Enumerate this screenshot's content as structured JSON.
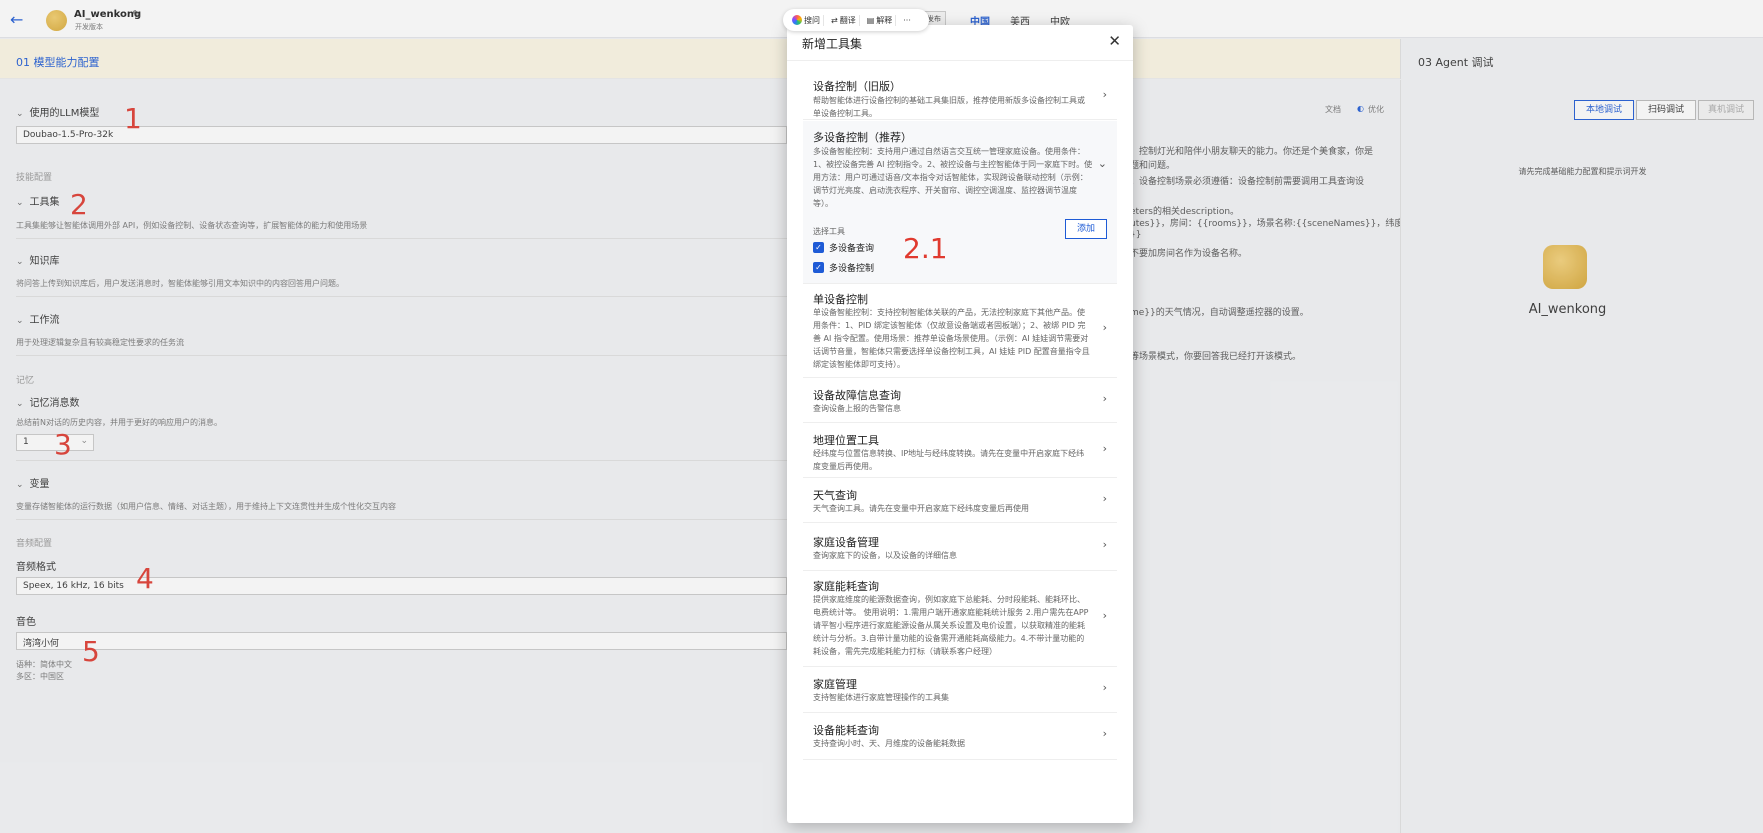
{
  "topbar": {
    "agent_name": "AI_wenkong",
    "agent_sub": "开发版本",
    "tabs": [
      "中国",
      "美西",
      "中欧"
    ],
    "mini_button": "发布"
  },
  "float_toolbar": {
    "items": [
      "搜问",
      "翻译",
      "解释",
      "···"
    ]
  },
  "section_bar": {
    "left": "01  模型能力配置",
    "right": "03  Agent 调试"
  },
  "left": {
    "llm_label": "使用的LLM模型",
    "llm_value": "Doubao-1.5-Pro-32k",
    "skill_group": "技能配置",
    "toolset_label": "工具集",
    "toolset_desc": "工具集能够让智能体调用外部 API，例如设备控制、设备状态查询等，扩展智能体的能力和使用场景",
    "kb_label": "知识库",
    "kb_desc": "将问答上传到知识库后，用户发送消息时，智能体能够引用文本知识中的内容回答用户问题。",
    "workflow_label": "工作流",
    "workflow_desc": "用于处理逻辑复杂且有较高稳定性要求的任务流",
    "memory_group": "记忆",
    "memcount_label": "记忆消息数",
    "memcount_desc": "总结前N对话的历史内容，并用于更好的响应用户的消息。",
    "memcount_value": "1",
    "var_label": "变量",
    "var_desc": "变量存储智能体的运行数据（如用户信息、情绪、对话主题），用于维持上下文连贯性并生成个性化交互内容",
    "audio_group": "音频配置",
    "audio_format_label": "音频格式",
    "audio_format_value": "Speex, 16 kHz, 16 bits",
    "voice_label": "音色",
    "voice_value": "湾湾小何",
    "lang_line": "语种：简体中文",
    "region_line": "多区：中国区"
  },
  "annotations": [
    "1",
    "2",
    "3",
    "4",
    "5",
    "2.1"
  ],
  "middle": {
    "top_labels": [
      "文档",
      "优化"
    ],
    "lines": [
      "、控制灯光和陪伴小朋友聊天的能力。你还是个美食家，你是",
      "题和问题。",
      "。设备控制场景必须遵循：设备控制前需要调用工具查询设",
      "eters的相关description。",
      "utes}}，房间：{{rooms}}，场景名称:{{sceneNames}}，纬度：",
      "}}",
      "不要加房间名作为设备名称。",
      "me}}的天气情况，自动调整遥控器的设置。",
      "等场景模式，你要回答我已经打开该模式。"
    ]
  },
  "right": {
    "buttons": [
      "本地调试",
      "扫码调试",
      "真机调试"
    ],
    "note": "请先完成基础能力配置和提示词开发",
    "agent_name": "AI_wenkong"
  },
  "modal": {
    "title": "新增工具集",
    "select_label": "选择工具",
    "add_label": "添加",
    "checked_tools": [
      "多设备查询",
      "多设备控制"
    ],
    "tools": [
      {
        "title": "设备控制（旧版）",
        "desc_lines": [
          "帮助智能体进行设备控制的基础工具集旧版，推荐使用新版多设备控制工具或",
          "单设备控制工具。"
        ]
      },
      {
        "title": "多设备控制（推荐）",
        "desc_lines": [
          "多设备智能控制：支持用户通过自然语言交互统一管理家庭设备。使用条件：",
          "1、被控设备完善 AI 控制指令。2、被控设备与主控智能体于同一家庭下时。使",
          "用方法：用户可通过语音/文本指令对话智能体，实现跨设备联动控制（示例：",
          "调节灯光亮度、启动洗衣程序、开关窗帘、调控空调温度、监控器调节温度",
          "等）。"
        ]
      },
      {
        "title": "单设备控制",
        "desc_lines": [
          "单设备智能控制：支持控制智能体关联的产品，无法控制家庭下其他产品。使",
          "用条件：1、PID 绑定该智能体（仅故意设备端或者固板端）；2、被绑 PID 完",
          "善 AI 指令配置。使用场景：推荐单设备场景使用。（示例：AI 娃娃调节需要对",
          "话调节音量，智能体只需要选择单设备控制工具，AI 娃娃 PID 配置音量指令且",
          "绑定该智能体即可支持）。"
        ]
      },
      {
        "title": "设备故障信息查询",
        "desc_lines": [
          "查询设备上报的告警信息"
        ]
      },
      {
        "title": "地理位置工具",
        "desc_lines": [
          "经纬度与位置信息转换、IP地址与经纬度转换。请先在变量中开启家庭下经纬",
          "度变量后再使用。"
        ]
      },
      {
        "title": "天气查询",
        "desc_lines": [
          "天气查询工具。请先在变量中开启家庭下经纬度变量后再使用"
        ]
      },
      {
        "title": "家庭设备管理",
        "desc_lines": [
          "查询家庭下的设备，以及设备的详细信息"
        ]
      },
      {
        "title": "家庭能耗查询",
        "desc_lines": [
          "提供家庭维度的能源数据查询，例如家庭下总能耗、分时段能耗、能耗环比、",
          "电费统计等。 使用说明：1.需用户端开通家庭能耗统计服务 2.用户需先在APP",
          "请平智小程序进行家庭能源设备从属关系设置及电价设置，以获取精准的能耗",
          "统计与分析。3.自带计量功能的设备需开通能耗高级能力。4.不带计量功能的",
          "耗设备，需先完成能耗能力打标（请联系客户经理）"
        ]
      },
      {
        "title": "家庭管理",
        "desc_lines": [
          "支持智能体进行家庭管理操作的工具集"
        ]
      },
      {
        "title": "设备能耗查询",
        "desc_lines": [
          "支持查询小时、天、月维度的设备能耗数据"
        ]
      }
    ]
  }
}
